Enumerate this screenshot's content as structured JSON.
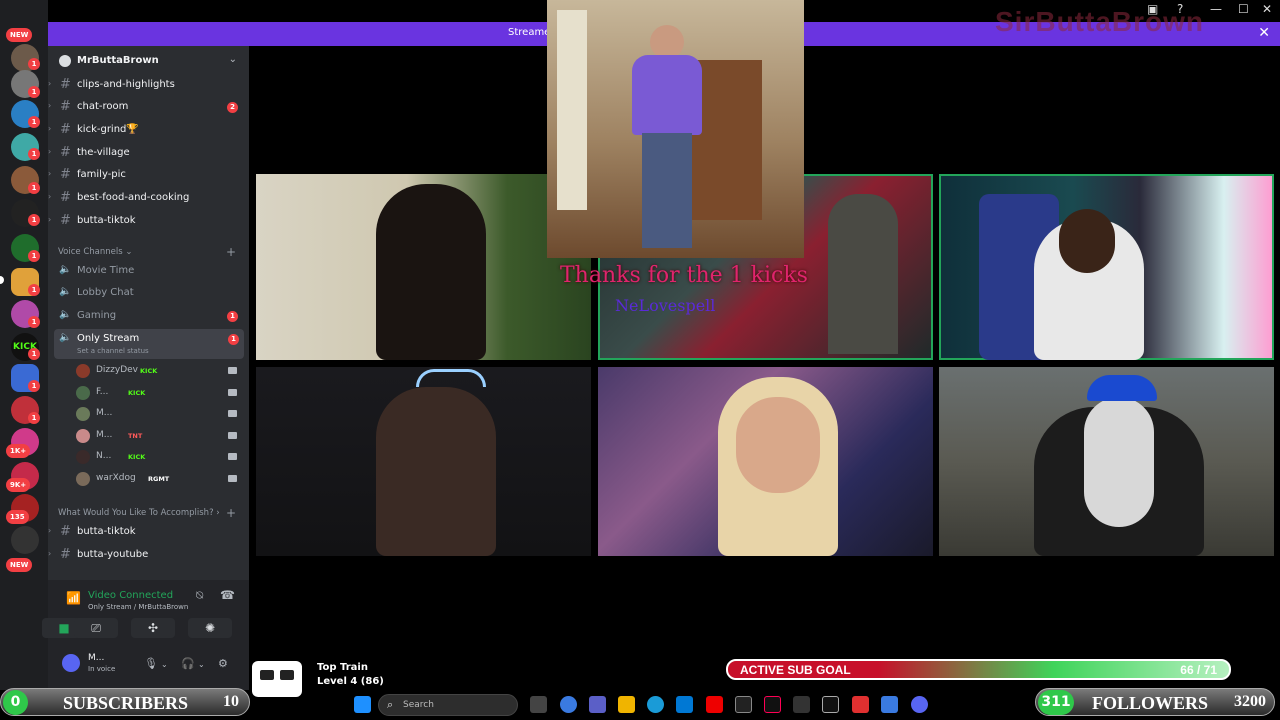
{
  "window": {
    "banner_text": "Streamer",
    "brand_watermark": "SirButtaBrown"
  },
  "server_rail": {
    "badges": [
      "NEW",
      "1",
      "1",
      "1",
      "1",
      "1",
      "1",
      "1",
      "1",
      "1",
      "1",
      "1",
      "1",
      "1K+",
      "9K+",
      "135",
      "NEW"
    ]
  },
  "sidebar": {
    "server_name": "MrButtaBrown",
    "text_channels": [
      {
        "name": "clips-and-highlights",
        "unread": ""
      },
      {
        "name": "chat-room",
        "unread": "2"
      },
      {
        "name": "kick-grind🏆",
        "unread": ""
      },
      {
        "name": "the-village",
        "unread": ""
      },
      {
        "name": "family-pic",
        "unread": ""
      },
      {
        "name": "best-food-and-cooking",
        "unread": ""
      },
      {
        "name": "butta-tiktok",
        "unread": ""
      }
    ],
    "voice_category": "Voice Channels",
    "voice_channels": [
      {
        "name": "Movie Time",
        "unread": ""
      },
      {
        "name": "Lobby Chat",
        "unread": ""
      },
      {
        "name": "Gaming",
        "unread": "1"
      }
    ],
    "active_voice": {
      "name": "Only Stream",
      "status": "Set a channel status",
      "unread": "1"
    },
    "members": [
      {
        "name": "DizzyDev",
        "tag": "KICK",
        "tag_color": "#53fc18"
      },
      {
        "name": "F...",
        "tag": "KICK",
        "tag_color": "#53fc18"
      },
      {
        "name": "M...",
        "tag": "",
        "tag_color": "#ffffff"
      },
      {
        "name": "M...",
        "tag": "TNT",
        "tag_color": "#ff5a5a"
      },
      {
        "name": "N...",
        "tag": "KICK",
        "tag_color": "#53fc18"
      },
      {
        "name": "warXdog",
        "tag": "RGMT",
        "tag_color": "#ffffff"
      }
    ],
    "category2": "What Would You Like To Accomplish?",
    "extra_channels": [
      {
        "name": "butta-tiktok"
      },
      {
        "name": "butta-youtube"
      }
    ]
  },
  "voice_panel": {
    "status": "Video Connected",
    "location": "Only Stream / MrButtaBrown",
    "user_name": "M...",
    "user_status": "In voice"
  },
  "alerts": {
    "kick_message": "Thanks for the 1 kicks",
    "kick_user": "NeLovespell"
  },
  "overlays": {
    "sub_goal_label": "ACTIVE SUB GOAL",
    "sub_goal_count": "66 / 71",
    "sub_goal_progress": 0.93,
    "subscribers_count": "0",
    "subscribers_label": "SUBSCRIBERS",
    "subscribers_goal": "10",
    "followers_count": "311",
    "followers_label": "FOLLOWERS",
    "followers_goal": "3200",
    "train_title": "Top Train",
    "train_level": "Level 4 (86)"
  },
  "taskbar": {
    "search_label": "Search"
  },
  "colors": {
    "accent": "#6a34e0",
    "speaking": "#23a55a",
    "unread": "#f23f43"
  }
}
